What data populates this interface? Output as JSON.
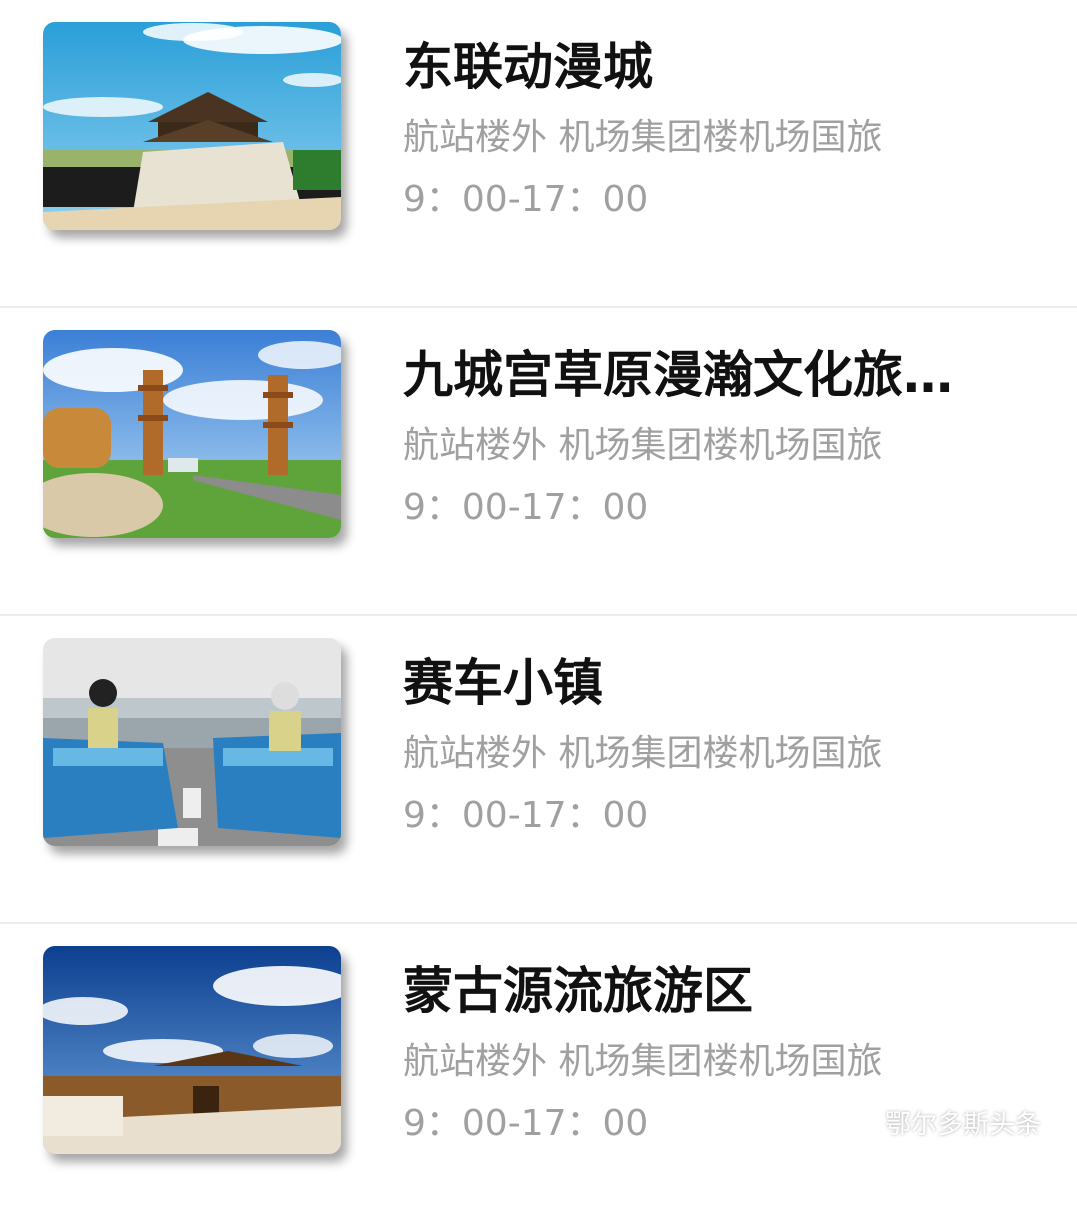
{
  "items": [
    {
      "title": "东联动漫城",
      "address": "航站楼外 机场集团楼机场国旅",
      "hours": "9：00-17：00",
      "image": "pagoda-fort-photo"
    },
    {
      "title": "九城宫草原漫瀚文化旅…",
      "address": "航站楼外 机场集团楼机场国旅",
      "hours": "9：00-17：00",
      "image": "grassland-towers-photo"
    },
    {
      "title": "赛车小镇",
      "address": "航站楼外 机场集团楼机场国旅",
      "hours": "9：00-17：00",
      "image": "go-kart-photo"
    },
    {
      "title": "蒙古源流旅游区",
      "address": "航站楼外 机场集团楼机场国旅",
      "hours": "9：00-17：00",
      "image": "palace-gate-photo"
    }
  ],
  "watermark": {
    "text": "鄂尔多斯头条",
    "icon": "wechat-icon"
  }
}
